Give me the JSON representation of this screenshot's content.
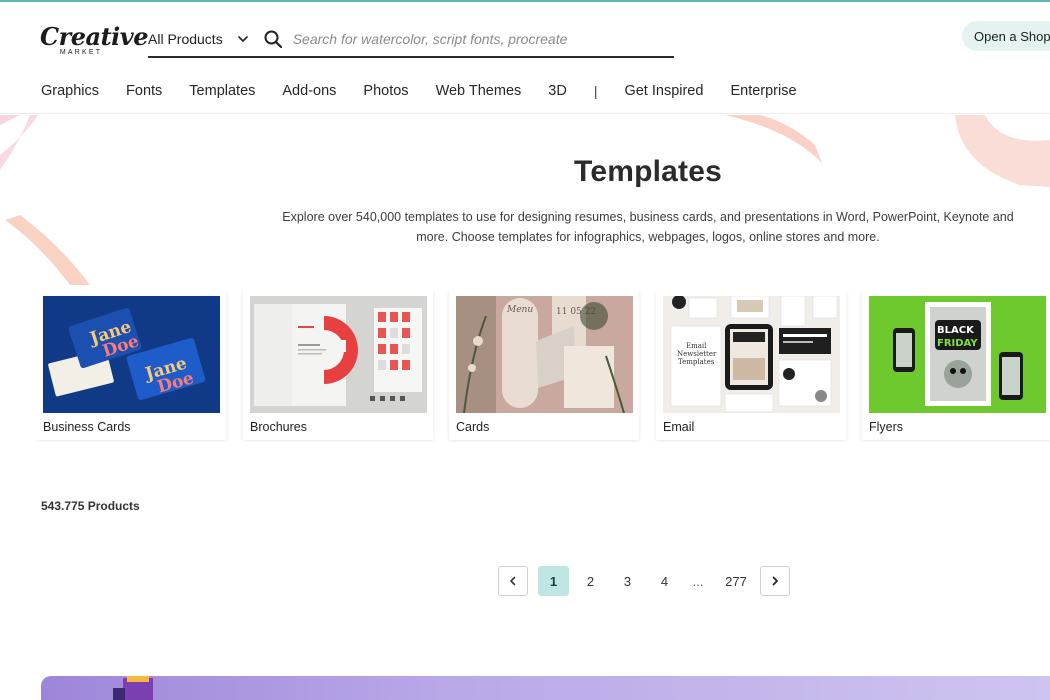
{
  "brand": {
    "logo_main": "Creative",
    "logo_sub": "MARKET"
  },
  "search": {
    "category": "All Products",
    "placeholder": "Search for watercolor, script fonts, procreate"
  },
  "header": {
    "open_shop": "Open a Shop"
  },
  "nav": {
    "items": [
      "Graphics",
      "Fonts",
      "Templates",
      "Add-ons",
      "Photos",
      "Web Themes",
      "3D"
    ],
    "separator": "|",
    "items_right": [
      "Get Inspired",
      "Enterprise"
    ]
  },
  "hero": {
    "title": "Templates",
    "description": "Explore over 540,000 templates to use for designing resumes, business cards, and presentations in Word, PowerPoint, Keynote and more. Choose templates for infographics, webpages, logos, online stores and more."
  },
  "categories": [
    {
      "label": "Business Cards"
    },
    {
      "label": "Brochures"
    },
    {
      "label": "Cards"
    },
    {
      "label": "Email"
    },
    {
      "label": "Flyers"
    }
  ],
  "card_text": {
    "business_cards": {
      "line1": "Jane",
      "line2": "Doe"
    },
    "cards": {
      "menu": "Menu",
      "date": "11 05 22"
    },
    "email": {
      "line1": "Email",
      "line2": "Newsletter",
      "line3": "Templates"
    },
    "flyers": {
      "line1": "BLACK",
      "line2": "FRIDAY"
    }
  },
  "results": {
    "count": "543.775 Products"
  },
  "pagination": {
    "current": "1",
    "pages": [
      "2",
      "3",
      "4"
    ],
    "ellipsis": "...",
    "last": "277"
  },
  "colors": {
    "accent_top": "#5fb8ae",
    "active_page": "#bfe6e2",
    "open_shop_bg": "#e4f3f1",
    "banner": "#b9a8e8"
  }
}
